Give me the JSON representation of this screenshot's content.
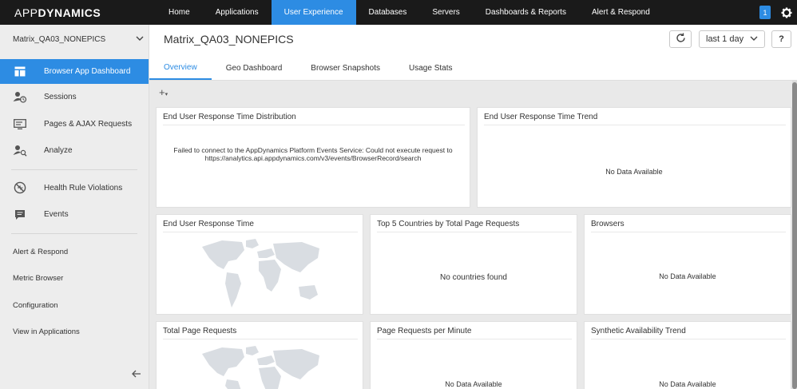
{
  "brand": {
    "prefix": "APP",
    "suffix": "DYNAMICS"
  },
  "topnav": {
    "items": [
      "Home",
      "Applications",
      "User Experience",
      "Databases",
      "Servers",
      "Dashboards & Reports",
      "Alert & Respond"
    ],
    "active_index": 2,
    "notification_count": "1"
  },
  "sidebar": {
    "app_name": "Matrix_QA03_NONEPICS",
    "menu": [
      {
        "label": "Browser App Dashboard",
        "icon": "dashboard-icon"
      },
      {
        "label": "Sessions",
        "icon": "sessions-icon"
      },
      {
        "label": "Pages & AJAX Requests",
        "icon": "pages-icon"
      },
      {
        "label": "Analyze",
        "icon": "analyze-icon"
      },
      {
        "label": "Health Rule Violations",
        "icon": "health-rule-icon"
      },
      {
        "label": "Events",
        "icon": "events-icon"
      }
    ],
    "links": [
      "Alert & Respond",
      "Metric Browser",
      "Configuration",
      "View in Applications"
    ]
  },
  "header": {
    "title": "Matrix_QA03_NONEPICS",
    "time_range": "last 1 day",
    "help": "?"
  },
  "tabs": [
    "Overview",
    "Geo Dashboard",
    "Browser Snapshots",
    "Usage Stats"
  ],
  "toolbar": {
    "add": "+"
  },
  "widgets": {
    "distribution": {
      "title": "End User Response Time Distribution",
      "error": "Failed to connect to the AppDynamics Platform Events Service: Could not execute request to https://analytics.api.appdynamics.com/v3/events/BrowserRecord/search"
    },
    "trend": {
      "title": "End User Response Time Trend",
      "message": "No Data Available"
    },
    "eurt": {
      "title": "End User Response Time"
    },
    "countries": {
      "title": "Top 5 Countries by Total Page Requests",
      "message": "No countries found"
    },
    "browsers": {
      "title": "Browsers",
      "message": "No Data Available"
    },
    "total_requests": {
      "title": "Total Page Requests"
    },
    "per_minute": {
      "title": "Page Requests per Minute",
      "message": "No Data Available"
    },
    "synthetic": {
      "title": "Synthetic Availability Trend",
      "message": "No Data Available"
    }
  },
  "colors": {
    "accent": "#2d8ce3",
    "nav_bg": "#1a1a1a",
    "map": "#d9dde2"
  }
}
